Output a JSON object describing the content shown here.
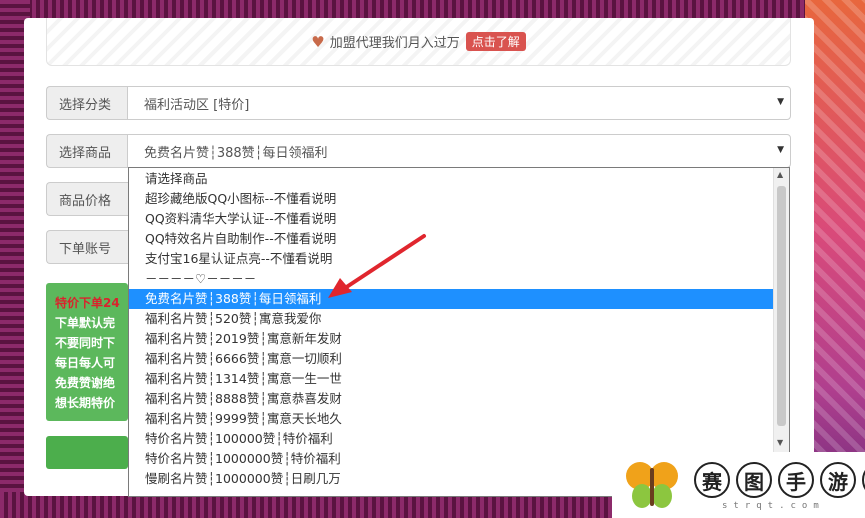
{
  "banner": {
    "text": "加盟代理我们月入过万",
    "button": "点击了解"
  },
  "form": {
    "category_label": "选择分类",
    "category_value": "福利活动区 [特价]",
    "product_label": "选择商品",
    "product_value": "免费名片赞┆388赞┆每日领福利",
    "price_label": "商品价格",
    "account_label": "下单账号"
  },
  "notice": {
    "lines": [
      "特价下单24",
      "下单默认完",
      "不要同时下",
      "每日每人可",
      "免费赞谢绝",
      "想长期特价"
    ]
  },
  "dropdown": {
    "selected_index": 6,
    "options": [
      "请选择商品",
      "超珍藏绝版QQ小图标--不懂看说明",
      "QQ资料清华大学认证--不懂看说明",
      "QQ特效名片自助制作--不懂看说明",
      "支付宝16星认证点亮--不懂看说明",
      "－－－－♡－－－－",
      "免费名片赞┆388赞┆每日领福利",
      "福利名片赞┆520赞┆寓意我爱你",
      "福利名片赞┆2019赞┆寓意新年发财",
      "福利名片赞┆6666赞┆寓意一切顺利",
      "福利名片赞┆1314赞┆寓意一生一世",
      "福利名片赞┆8888赞┆寓意恭喜发财",
      "福利名片赞┆9999赞┆寓意天长地久",
      "特价名片赞┆100000赞┆特价福利",
      "特价名片赞┆1000000赞┆特价福利",
      "慢刷名片赞┆1000000赞┆日刷几万"
    ]
  },
  "watermark": {
    "chars": [
      "赛",
      "图",
      "手",
      "游",
      "网"
    ],
    "sub": "strqt.com"
  },
  "colors": {
    "selected": "#1e90ff",
    "notice_bg": "#5cb85c",
    "banner_button": "#d9534f",
    "arrow": "#e0262e"
  }
}
